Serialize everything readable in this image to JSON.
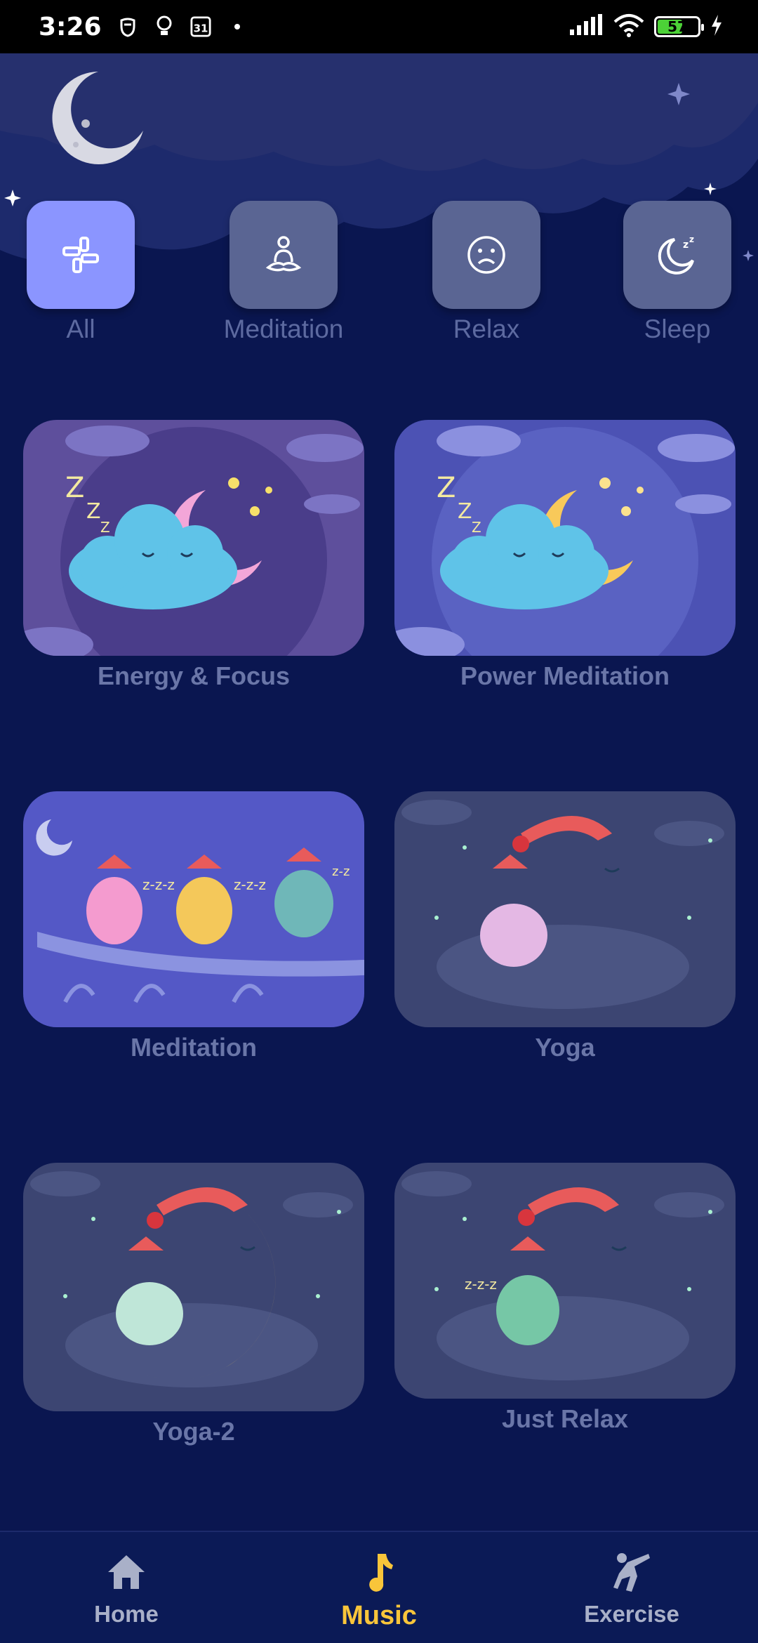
{
  "status_bar": {
    "time": "3:26",
    "battery": "57"
  },
  "categories": [
    {
      "label": "All",
      "icon": "dashboard-icon",
      "active": true
    },
    {
      "label": "Meditation",
      "icon": "meditation-icon",
      "active": false
    },
    {
      "label": "Relax",
      "icon": "sad-face-icon",
      "active": false
    },
    {
      "label": "Sleep",
      "icon": "moon-sleep-icon",
      "active": false
    }
  ],
  "cards": [
    {
      "title": "Energy & Focus"
    },
    {
      "title": "Power Meditation"
    },
    {
      "title": "Meditation"
    },
    {
      "title": "Yoga"
    },
    {
      "title": "Yoga-2"
    },
    {
      "title": "Just Relax"
    }
  ],
  "bottom_nav": {
    "home": "Home",
    "music": "Music",
    "exercise": "Exercise",
    "active": "music"
  },
  "colors": {
    "background": "#0a1650",
    "active_chip": "#8b95ff",
    "chip": "#5a6593",
    "active_nav": "#f9c53a"
  }
}
